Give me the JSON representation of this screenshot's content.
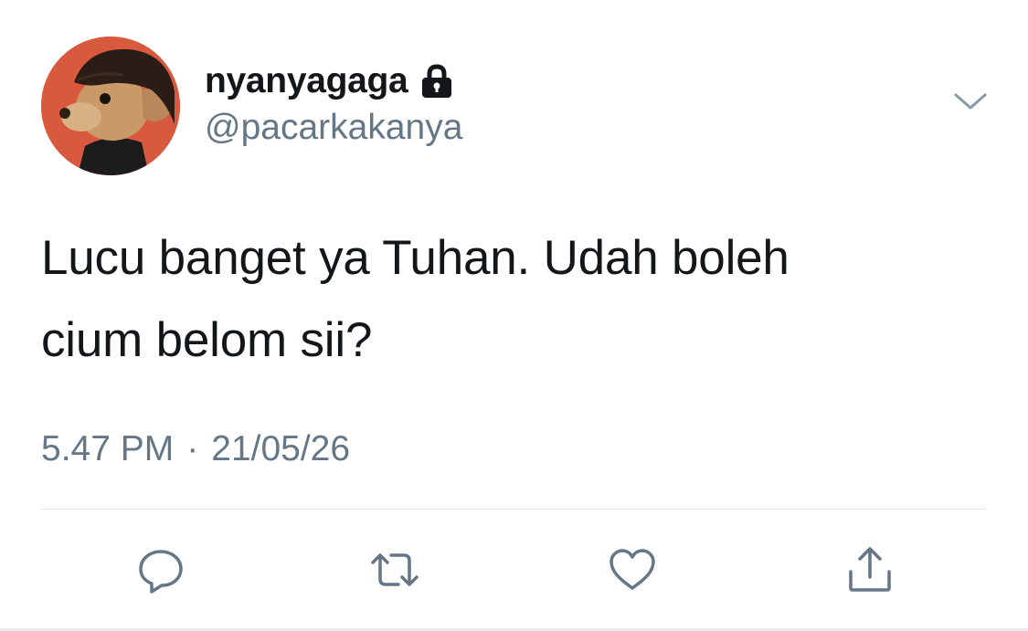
{
  "tweet": {
    "display_name": "nyanyagaga",
    "handle": "@pacarkakanya",
    "protected": true,
    "text_line_1": "Lucu banget ya Tuhan. Udah boleh",
    "text_line_2": "cium belom sii?",
    "time": "5.47 PM",
    "separator": "·",
    "date": "21/05/26"
  },
  "icons": {
    "lock": "lock-icon",
    "more": "chevron-down-icon",
    "reply": "reply-icon",
    "retweet": "retweet-icon",
    "like": "heart-icon",
    "share": "share-icon"
  },
  "colors": {
    "text_primary": "#14171a",
    "text_secondary": "#657786",
    "icon": "#657786",
    "divider": "#e1e8ed"
  }
}
